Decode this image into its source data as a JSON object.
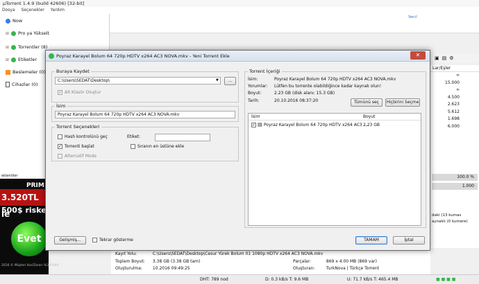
{
  "app": {
    "title": "µTorrent 1.4.9  (build 42606) [32-bit]",
    "menu": [
      "Dosya",
      "Seçenekler",
      "Yardım"
    ],
    "sidebar": [
      {
        "label": "Now",
        "color": "#2f80ed"
      },
      {
        "label": "Pro ya Yükselt",
        "color": "#39b54a"
      },
      {
        "label": "Torrentler (8)",
        "color": "#39b54a"
      },
      {
        "label": "Etiketler",
        "color": "#39b54a"
      },
      {
        "label": "Beslemeler (0)",
        "color": "#f7931e"
      },
      {
        "label": "Cihazlar (0)",
        "color": "#555555"
      }
    ],
    "tab_new": "Yeni!",
    "right_column": {
      "header": "Lar/Eşler",
      "values": [
        "∞",
        "15.000",
        "∞",
        "4.500",
        "2.623",
        "5.612",
        "1.698",
        "6.000"
      ]
    },
    "right_bars": [
      "100.0 %",
      "1.000"
    ],
    "right_text": [
      "daki (13 kumas",
      "aynaklı (0 kumere)"
    ],
    "ad": {
      "strip": "eklentiler",
      "brand": "PRIM",
      "amount": "3.520TL le",
      "risk": "500$ riske",
      "button": "Evet",
      "footer": "2016 © Müşteri Kar/Zararı %36/%64"
    },
    "details": {
      "save_as_label": "Kayıt Yolu:",
      "save_as_value": "C:\\Users\\SEDAT\\Desktop\\Cesur Yürek Bolum 01 1080p HDTV x264 AC3 NOVA.mkv",
      "total_size_label": "Toplam Boyut:",
      "total_size_value": "3.38 GB (3.38 GB tam)",
      "created_label": "Oluşturulma:",
      "created_value": "10.2016 09:49:25",
      "pieces_label": "Parçalar:",
      "pieces_value": "869 x 4.00 MB (869 var)",
      "creator_label": "Oluşturan:",
      "creator_value": "TurkNova | Türkçe Torrent"
    },
    "status": {
      "dht": "DHT: 789 nod",
      "down": "D: 0.3 kB/s T: 9.6 MB",
      "up": "U: 71.7 kB/s T: 465.4 MB"
    }
  },
  "dialog": {
    "title": "Poyraz Karayel Bolum 64 720p HDTV x264 AC3 NOVA.mkv - Yeni Torrent Ekle",
    "save_group_label": "Buraya Kaydet",
    "save_path": "C:\\Users\\SEDAT\\Desktop\\",
    "browse_label": "...",
    "subfolder_label": "Alt Klasör Oluştur",
    "name_group_label": "İsim",
    "name_value": "Poyraz Karayel Bolum 64 720p HDTV x264 AC3 NOVA.mkv",
    "options_group_label": "Torrent Seçenekleri",
    "hash_check_label": "Hash kontrolünü geç",
    "start_torrent_label": "Torrenti başlat",
    "alternative_mode_label": "Alternatif Mode",
    "label_label": "Etiket:",
    "queue_top_label": "Sıranın en üstüne ekle",
    "content_group_label": "Torrent İçeriği",
    "info_name_label": "İsim:",
    "info_name_value": "Poyraz Karayel Bolum 64 720p HDTV x264 AC3 NOVA.mkv",
    "info_comment_label": "Yorumlar:",
    "info_comment_value": "Lütfen bu torrente olabildiğince kadar kaynak olun!",
    "info_size_label": "Boyut:",
    "info_size_value": "2.23 GB (disk alanı: 15.3 GB)",
    "info_date_label": "Tarih:",
    "info_date_value": "20.10.2016 08:37:20",
    "select_all_label": "Tümünü seç",
    "select_none_label": "Hiçbirini Seçme",
    "files_header_name": "İsim",
    "files_header_size": "Boyut",
    "files": [
      {
        "name": "Poyraz Karayel Bolum 64 720p HDTV x264 AC3 ...",
        "size": "2.23 GB"
      }
    ],
    "advanced_label": "Gelişmiş...",
    "dont_show_label": "Tekrar gösterme",
    "ok_label": "TAMAM",
    "cancel_label": "İptal"
  }
}
